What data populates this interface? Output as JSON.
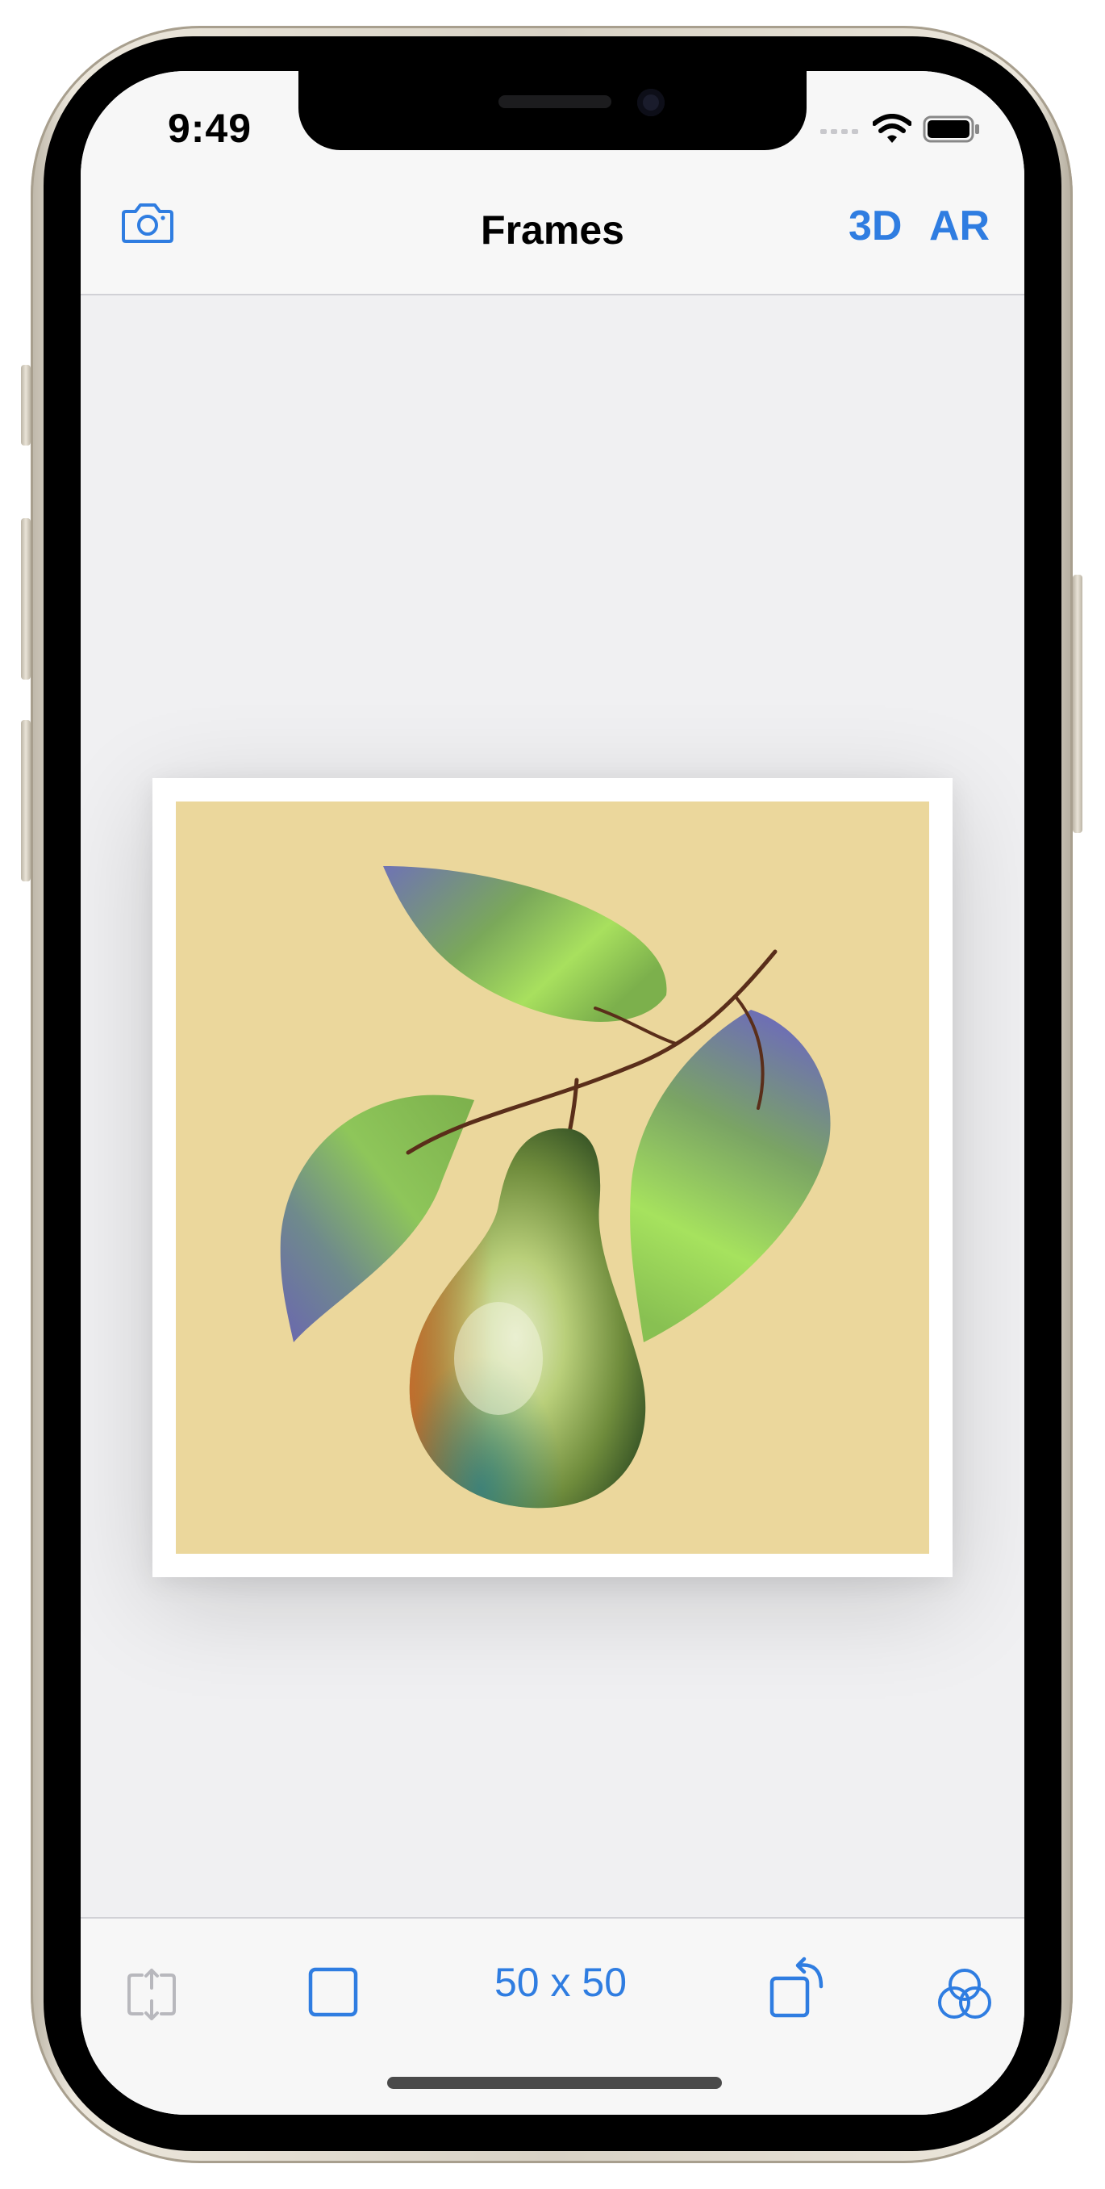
{
  "status_bar": {
    "time": "9:49",
    "icons": [
      "cellular-signal-icon",
      "wifi-icon",
      "battery-icon"
    ]
  },
  "navigation": {
    "title": "Frames",
    "left_icon": "camera-icon",
    "right_buttons": {
      "three_d": "3D",
      "ar": "AR"
    }
  },
  "canvas": {
    "artwork_subject": "pear-on-branch-illustration",
    "artwork_background_color": "#ebd79c",
    "frame_color": "#ffffff"
  },
  "toolbar": {
    "items": [
      "resize-arrows-icon",
      "square-frame-icon",
      "size-label",
      "rotate-icon",
      "color-filters-icon"
    ],
    "size_label": "50 x 50",
    "resize_disabled": true
  },
  "colors": {
    "accent": "#2f7de1",
    "disabled": "#b8b8bd",
    "background": "#f0f0f2",
    "bar_background": "#f7f7f7"
  }
}
